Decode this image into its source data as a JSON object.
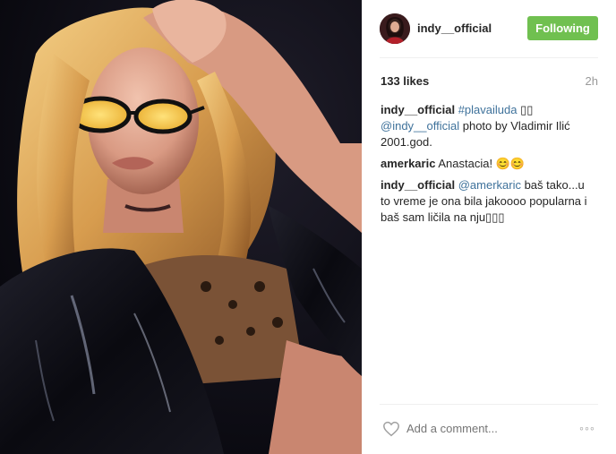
{
  "post": {
    "username": "indy__official",
    "follow_label": "Following",
    "likes": "133 likes",
    "time": "2h",
    "comments": [
      {
        "user": "indy__official",
        "parts": [
          {
            "kind": "link",
            "text": "#plavailuda"
          },
          {
            "kind": "text",
            "text": " ▯▯"
          },
          {
            "kind": "br",
            "text": ""
          },
          {
            "kind": "link",
            "text": "@indy__official"
          },
          {
            "kind": "text",
            "text": " photo by Vladimir Ilić 2001.god."
          }
        ]
      },
      {
        "user": "amerkaric",
        "parts": [
          {
            "kind": "text",
            "text": "Anastacia! 😊😊"
          }
        ]
      },
      {
        "user": "indy__official",
        "parts": [
          {
            "kind": "link",
            "text": "@amerkaric"
          },
          {
            "kind": "text",
            "text": " baš tako...u to vreme je ona bila jakoooo popularna i baš sam ličila na nju▯▯▯"
          }
        ]
      }
    ],
    "add_comment_placeholder": "Add a comment...",
    "more_label": "◦◦◦"
  },
  "icons": {
    "like": "heart-outline-icon",
    "more": "more-options-icon"
  },
  "colors": {
    "follow_button": "#70c050",
    "link": "#3f729b",
    "muted": "#999999"
  }
}
